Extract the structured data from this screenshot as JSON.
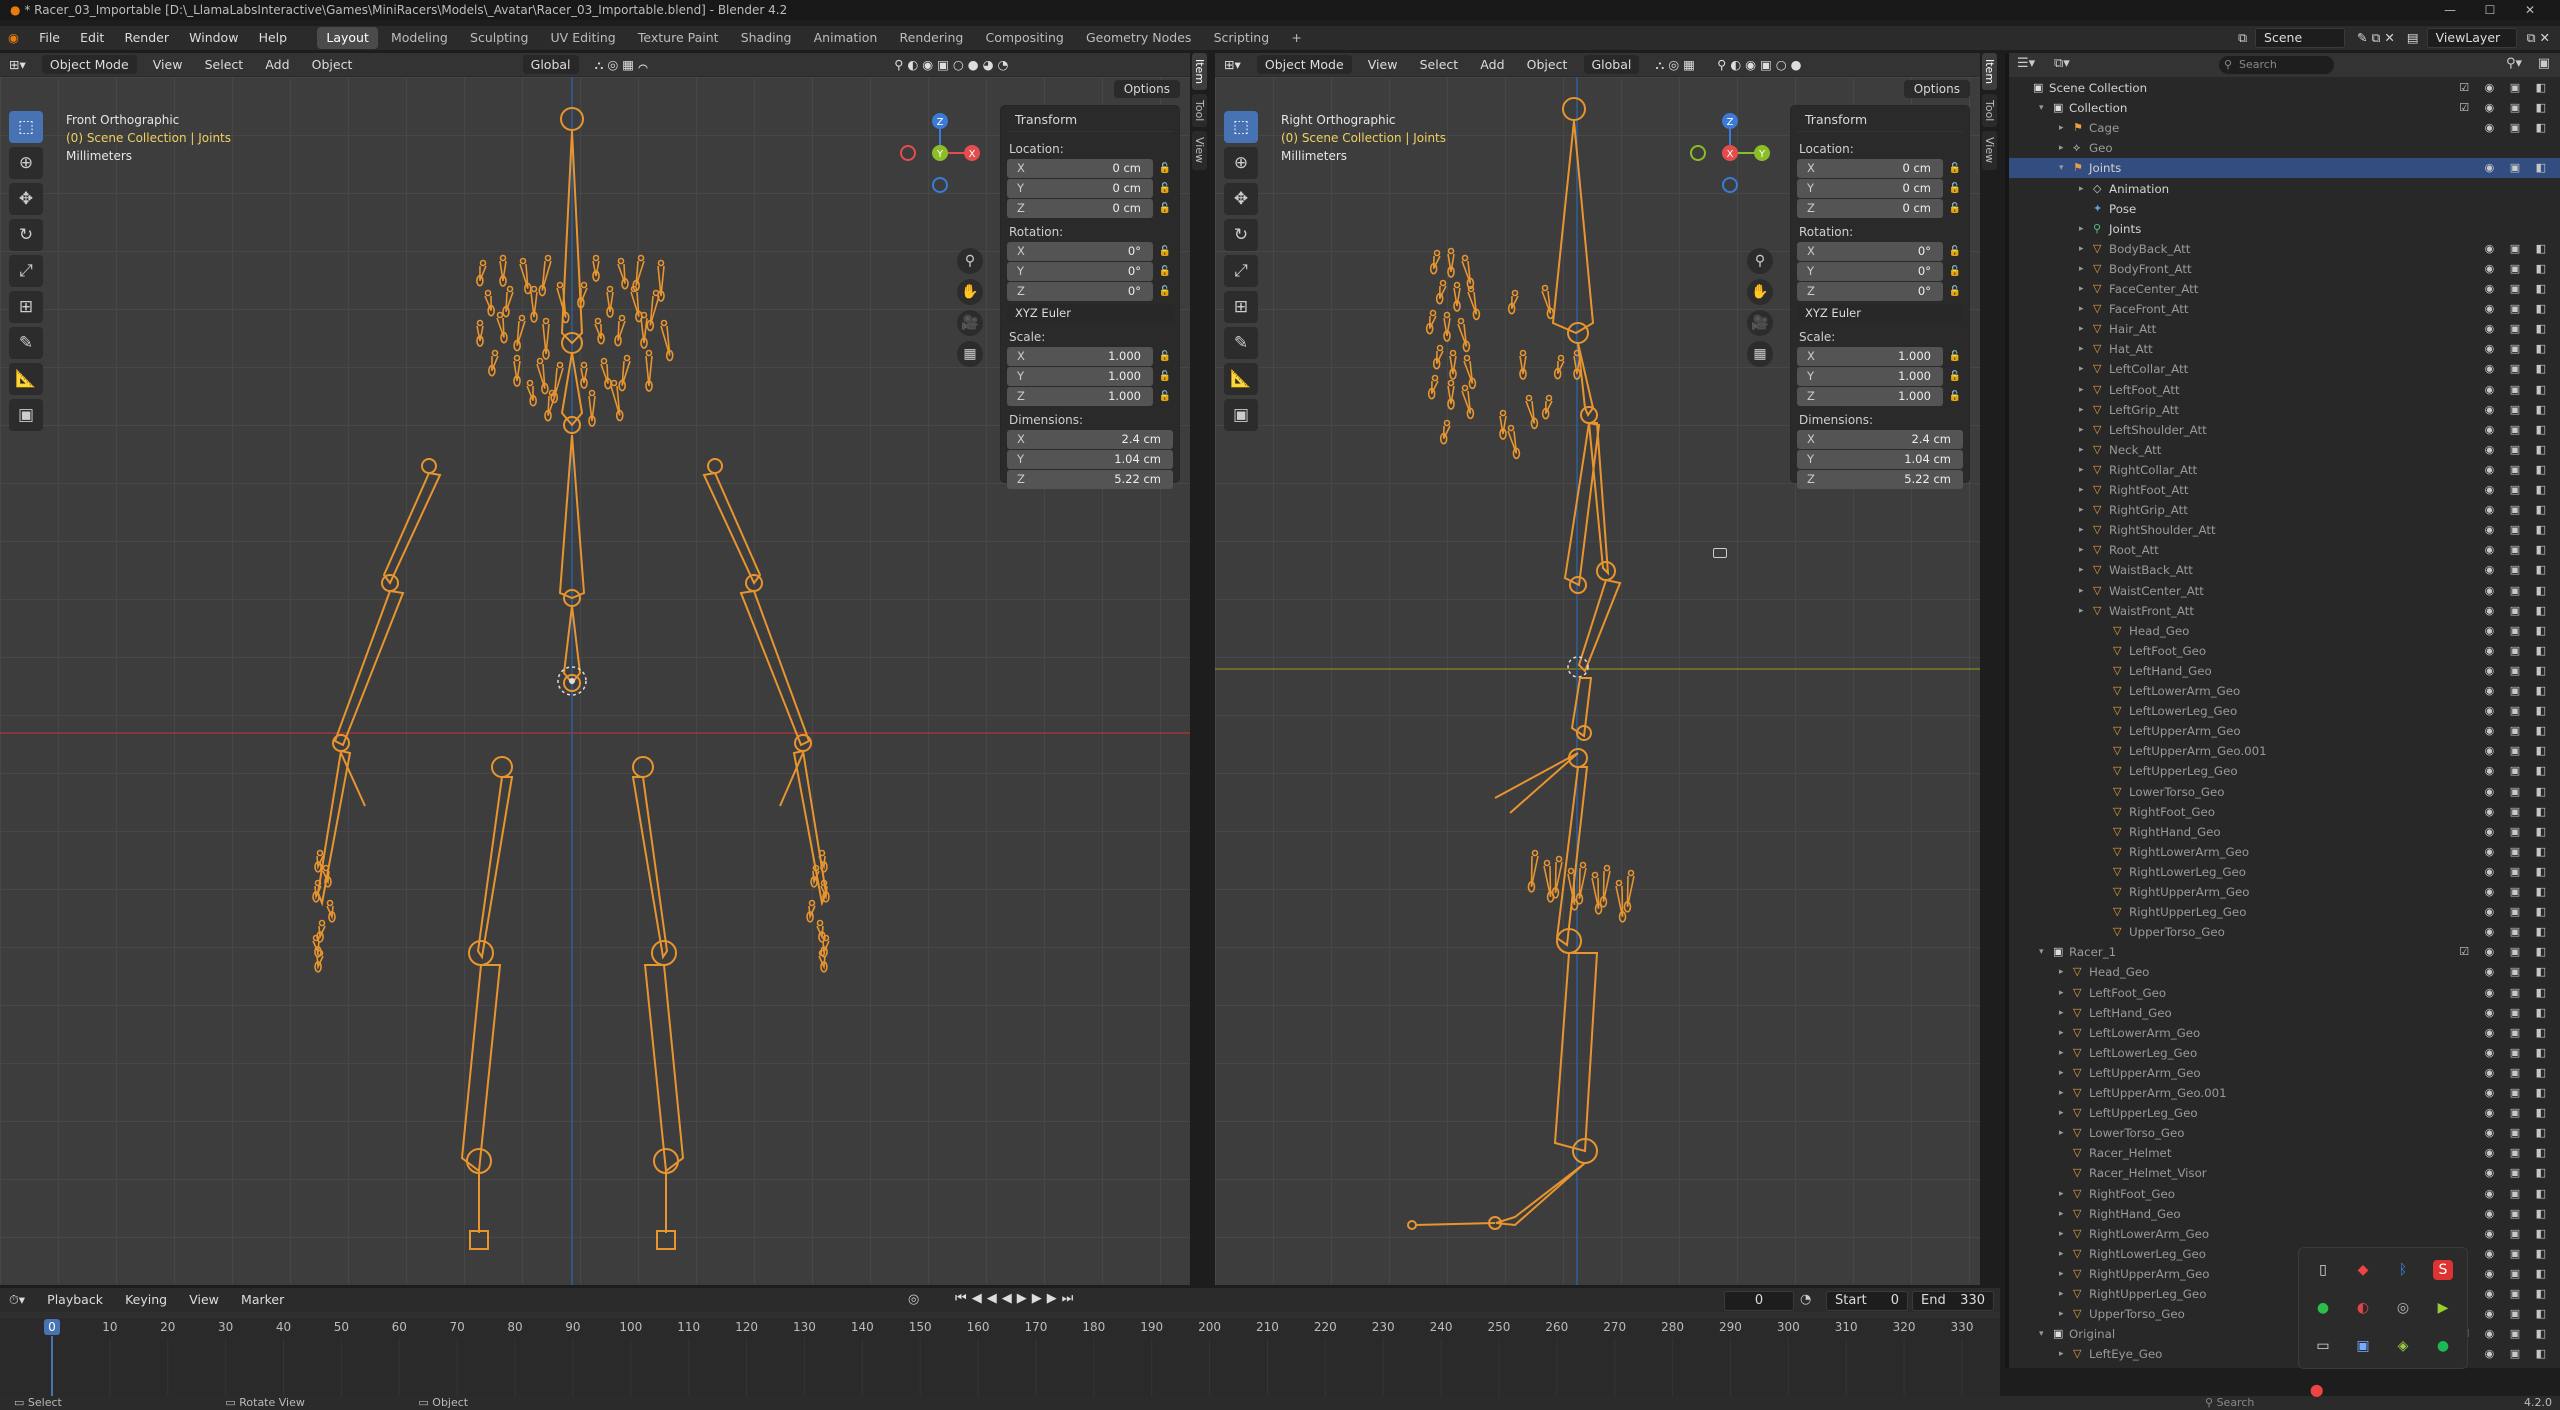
{
  "window": {
    "title": "* Racer_03_Importable [D:\\_LlamaLabsInteractive\\Games\\MiniRacers\\Models\\_Avatar\\Racer_03_Importable.blend] - Blender 4.2",
    "controls": [
      "—",
      "☐",
      "✕"
    ]
  },
  "menu": {
    "items": [
      "File",
      "Edit",
      "Render",
      "Window",
      "Help"
    ],
    "workspaces": [
      "Layout",
      "Modeling",
      "Sculpting",
      "UV Editing",
      "Texture Paint",
      "Shading",
      "Animation",
      "Rendering",
      "Compositing",
      "Geometry Nodes",
      "Scripting"
    ],
    "active_workspace": "Layout",
    "add_tab": "+",
    "scene_label": "Scene",
    "viewlayer_label": "ViewLayer"
  },
  "viewport_left": {
    "mode": "Object Mode",
    "menus": [
      "View",
      "Select",
      "Add",
      "Object"
    ],
    "orientation": "Global",
    "options": "Options",
    "view_name": "Front Orthographic",
    "collection": "(0) Scene Collection | Joints",
    "units": "Millimeters"
  },
  "viewport_right": {
    "mode": "Object Mode",
    "menus": [
      "View",
      "Select",
      "Add",
      "Object"
    ],
    "orientation": "Global",
    "options": "Options",
    "view_name": "Right Orthographic",
    "collection": "(0) Scene Collection | Joints",
    "units": "Millimeters"
  },
  "gizmo_left": {
    "z": "Z",
    "y": "Y",
    "x": "X"
  },
  "gizmo_right": {
    "z": "Z",
    "y": "Y",
    "x": "X"
  },
  "side_tabs": [
    "Item",
    "Tool",
    "View"
  ],
  "transform": {
    "title": "Transform",
    "location_label": "Location:",
    "location": [
      {
        "axis": "X",
        "value": "0 cm"
      },
      {
        "axis": "Y",
        "value": "0 cm"
      },
      {
        "axis": "Z",
        "value": "0 cm"
      }
    ],
    "rotation_label": "Rotation:",
    "rotation": [
      {
        "axis": "X",
        "value": "0°"
      },
      {
        "axis": "Y",
        "value": "0°"
      },
      {
        "axis": "Z",
        "value": "0°"
      }
    ],
    "rotation_mode": "XYZ Euler",
    "scale_label": "Scale:",
    "scale": [
      {
        "axis": "X",
        "value": "1.000"
      },
      {
        "axis": "Y",
        "value": "1.000"
      },
      {
        "axis": "Z",
        "value": "1.000"
      }
    ],
    "dimensions_label": "Dimensions:",
    "dimensions": [
      {
        "axis": "X",
        "value": "2.4 cm"
      },
      {
        "axis": "Y",
        "value": "1.04 cm"
      },
      {
        "axis": "Z",
        "value": "5.22 cm"
      }
    ]
  },
  "outliner": {
    "search_placeholder": "Search",
    "rows": [
      {
        "label": "Scene Collection",
        "depth": 0,
        "icon": "collection-icon",
        "arrow": ""
      },
      {
        "label": "Collection",
        "depth": 1,
        "icon": "collection-icon",
        "arrow": "▾"
      },
      {
        "label": "Cage",
        "depth": 2,
        "icon": "armature-icon",
        "arrow": "▸",
        "grey": true
      },
      {
        "label": "Geo",
        "depth": 2,
        "icon": "empty-icon",
        "arrow": "▸",
        "grey": true
      },
      {
        "label": "Joints",
        "depth": 2,
        "icon": "armature-icon",
        "arrow": "▾",
        "selected": true
      },
      {
        "label": "Animation",
        "depth": 3,
        "icon": "action-icon",
        "arrow": "▸"
      },
      {
        "label": "Pose",
        "depth": 3,
        "icon": "pose-icon",
        "arrow": ""
      },
      {
        "label": "Joints",
        "depth": 3,
        "icon": "armature-data-icon",
        "arrow": "▸"
      },
      {
        "label": "BodyBack_Att",
        "depth": 3,
        "icon": "mesh-icon",
        "arrow": "▸",
        "grey": true
      },
      {
        "label": "BodyFront_Att",
        "depth": 3,
        "icon": "mesh-icon",
        "arrow": "▸",
        "grey": true
      },
      {
        "label": "FaceCenter_Att",
        "depth": 3,
        "icon": "mesh-icon",
        "arrow": "▸",
        "grey": true
      },
      {
        "label": "FaceFront_Att",
        "depth": 3,
        "icon": "mesh-icon",
        "arrow": "▸",
        "grey": true
      },
      {
        "label": "Hair_Att",
        "depth": 3,
        "icon": "mesh-icon",
        "arrow": "▸",
        "grey": true
      },
      {
        "label": "Hat_Att",
        "depth": 3,
        "icon": "mesh-icon",
        "arrow": "▸",
        "grey": true
      },
      {
        "label": "LeftCollar_Att",
        "depth": 3,
        "icon": "mesh-icon",
        "arrow": "▸",
        "grey": true
      },
      {
        "label": "LeftFoot_Att",
        "depth": 3,
        "icon": "mesh-icon",
        "arrow": "▸",
        "grey": true
      },
      {
        "label": "LeftGrip_Att",
        "depth": 3,
        "icon": "mesh-icon",
        "arrow": "▸",
        "grey": true
      },
      {
        "label": "LeftShoulder_Att",
        "depth": 3,
        "icon": "mesh-icon",
        "arrow": "▸",
        "grey": true
      },
      {
        "label": "Neck_Att",
        "depth": 3,
        "icon": "mesh-icon",
        "arrow": "▸",
        "grey": true
      },
      {
        "label": "RightCollar_Att",
        "depth": 3,
        "icon": "mesh-icon",
        "arrow": "▸",
        "grey": true
      },
      {
        "label": "RightFoot_Att",
        "depth": 3,
        "icon": "mesh-icon",
        "arrow": "▸",
        "grey": true
      },
      {
        "label": "RightGrip_Att",
        "depth": 3,
        "icon": "mesh-icon",
        "arrow": "▸",
        "grey": true
      },
      {
        "label": "RightShoulder_Att",
        "depth": 3,
        "icon": "mesh-icon",
        "arrow": "▸",
        "grey": true
      },
      {
        "label": "Root_Att",
        "depth": 3,
        "icon": "mesh-icon",
        "arrow": "▸",
        "grey": true
      },
      {
        "label": "WaistBack_Att",
        "depth": 3,
        "icon": "mesh-icon",
        "arrow": "▸",
        "grey": true
      },
      {
        "label": "WaistCenter_Att",
        "depth": 3,
        "icon": "mesh-icon",
        "arrow": "▸",
        "grey": true
      },
      {
        "label": "WaistFront_Att",
        "depth": 3,
        "icon": "mesh-icon",
        "arrow": "▸",
        "grey": true
      },
      {
        "label": "Head_Geo",
        "depth": 4,
        "icon": "mesh-icon",
        "arrow": "",
        "grey": true
      },
      {
        "label": "LeftFoot_Geo",
        "depth": 4,
        "icon": "mesh-icon",
        "arrow": "",
        "grey": true
      },
      {
        "label": "LeftHand_Geo",
        "depth": 4,
        "icon": "mesh-icon",
        "arrow": "",
        "grey": true
      },
      {
        "label": "LeftLowerArm_Geo",
        "depth": 4,
        "icon": "mesh-icon",
        "arrow": "",
        "grey": true
      },
      {
        "label": "LeftLowerLeg_Geo",
        "depth": 4,
        "icon": "mesh-icon",
        "arrow": "",
        "grey": true
      },
      {
        "label": "LeftUpperArm_Geo",
        "depth": 4,
        "icon": "mesh-icon",
        "arrow": "",
        "grey": true
      },
      {
        "label": "LeftUpperArm_Geo.001",
        "depth": 4,
        "icon": "mesh-icon",
        "arrow": "",
        "grey": true
      },
      {
        "label": "LeftUpperLeg_Geo",
        "depth": 4,
        "icon": "mesh-icon",
        "arrow": "",
        "grey": true
      },
      {
        "label": "LowerTorso_Geo",
        "depth": 4,
        "icon": "mesh-icon",
        "arrow": "",
        "grey": true
      },
      {
        "label": "RightFoot_Geo",
        "depth": 4,
        "icon": "mesh-icon",
        "arrow": "",
        "grey": true
      },
      {
        "label": "RightHand_Geo",
        "depth": 4,
        "icon": "mesh-icon",
        "arrow": "",
        "grey": true
      },
      {
        "label": "RightLowerArm_Geo",
        "depth": 4,
        "icon": "mesh-icon",
        "arrow": "",
        "grey": true
      },
      {
        "label": "RightLowerLeg_Geo",
        "depth": 4,
        "icon": "mesh-icon",
        "arrow": "",
        "grey": true
      },
      {
        "label": "RightUpperArm_Geo",
        "depth": 4,
        "icon": "mesh-icon",
        "arrow": "",
        "grey": true
      },
      {
        "label": "RightUpperLeg_Geo",
        "depth": 4,
        "icon": "mesh-icon",
        "arrow": "",
        "grey": true
      },
      {
        "label": "UpperTorso_Geo",
        "depth": 4,
        "icon": "mesh-icon",
        "arrow": "",
        "grey": true
      },
      {
        "label": "Racer_1",
        "depth": 1,
        "icon": "collection-icon",
        "arrow": "▾",
        "grey": true
      },
      {
        "label": "Head_Geo",
        "depth": 2,
        "icon": "mesh-icon",
        "arrow": "▸",
        "grey": true
      },
      {
        "label": "LeftFoot_Geo",
        "depth": 2,
        "icon": "mesh-icon",
        "arrow": "▸",
        "grey": true
      },
      {
        "label": "LeftHand_Geo",
        "depth": 2,
        "icon": "mesh-icon",
        "arrow": "▸",
        "grey": true
      },
      {
        "label": "LeftLowerArm_Geo",
        "depth": 2,
        "icon": "mesh-icon",
        "arrow": "▸",
        "grey": true
      },
      {
        "label": "LeftLowerLeg_Geo",
        "depth": 2,
        "icon": "mesh-icon",
        "arrow": "▸",
        "grey": true
      },
      {
        "label": "LeftUpperArm_Geo",
        "depth": 2,
        "icon": "mesh-icon",
        "arrow": "▸",
        "grey": true
      },
      {
        "label": "LeftUpperArm_Geo.001",
        "depth": 2,
        "icon": "mesh-icon",
        "arrow": "▸",
        "grey": true
      },
      {
        "label": "LeftUpperLeg_Geo",
        "depth": 2,
        "icon": "mesh-icon",
        "arrow": "▸",
        "grey": true
      },
      {
        "label": "LowerTorso_Geo",
        "depth": 2,
        "icon": "mesh-icon",
        "arrow": "▸",
        "grey": true
      },
      {
        "label": "Racer_Helmet",
        "depth": 2,
        "icon": "mesh-icon",
        "arrow": "",
        "grey": true
      },
      {
        "label": "Racer_Helmet_Visor",
        "depth": 2,
        "icon": "mesh-icon",
        "arrow": "",
        "grey": true
      },
      {
        "label": "RightFoot_Geo",
        "depth": 2,
        "icon": "mesh-icon",
        "arrow": "▸",
        "grey": true
      },
      {
        "label": "RightHand_Geo",
        "depth": 2,
        "icon": "mesh-icon",
        "arrow": "▸",
        "grey": true
      },
      {
        "label": "RightLowerArm_Geo",
        "depth": 2,
        "icon": "mesh-icon",
        "arrow": "▸",
        "grey": true
      },
      {
        "label": "RightLowerLeg_Geo",
        "depth": 2,
        "icon": "mesh-icon",
        "arrow": "▸",
        "grey": true
      },
      {
        "label": "RightUpperArm_Geo",
        "depth": 2,
        "icon": "mesh-icon",
        "arrow": "▸",
        "grey": true
      },
      {
        "label": "RightUpperLeg_Geo",
        "depth": 2,
        "icon": "mesh-icon",
        "arrow": "▸",
        "grey": true
      },
      {
        "label": "UpperTorso_Geo",
        "depth": 2,
        "icon": "mesh-icon",
        "arrow": "▸",
        "grey": true
      },
      {
        "label": "Original",
        "depth": 1,
        "icon": "collection-icon",
        "arrow": "▾",
        "grey": true
      },
      {
        "label": "LeftEye_Geo",
        "depth": 2,
        "icon": "mesh-icon",
        "arrow": "▸",
        "grey": true
      }
    ]
  },
  "timeline": {
    "menus": [
      "Playback",
      "Keying",
      "View",
      "Marker"
    ],
    "current_frame": "0",
    "start_label": "Start",
    "start": "0",
    "end_label": "End",
    "end": "330",
    "ticks": [
      "0",
      "10",
      "20",
      "30",
      "40",
      "50",
      "60",
      "70",
      "80",
      "90",
      "100",
      "110",
      "120",
      "130",
      "140",
      "150",
      "160",
      "170",
      "180",
      "190",
      "200",
      "210",
      "220",
      "230",
      "240",
      "250",
      "260",
      "270",
      "280",
      "290",
      "300",
      "310",
      "320",
      "330"
    ]
  },
  "status": {
    "select": "Select",
    "rotate": "Rotate View",
    "object": "Object",
    "version": "4.2.0"
  },
  "outliner_bottom": {
    "search_placeholder": "Search"
  },
  "colors": {
    "accent": "#4772b3",
    "bone": "#e8952f",
    "selected_row": "#334d80",
    "x_axis": "#e54d4d",
    "y_axis": "#8bbd26",
    "z_axis": "#3b7bd6"
  }
}
